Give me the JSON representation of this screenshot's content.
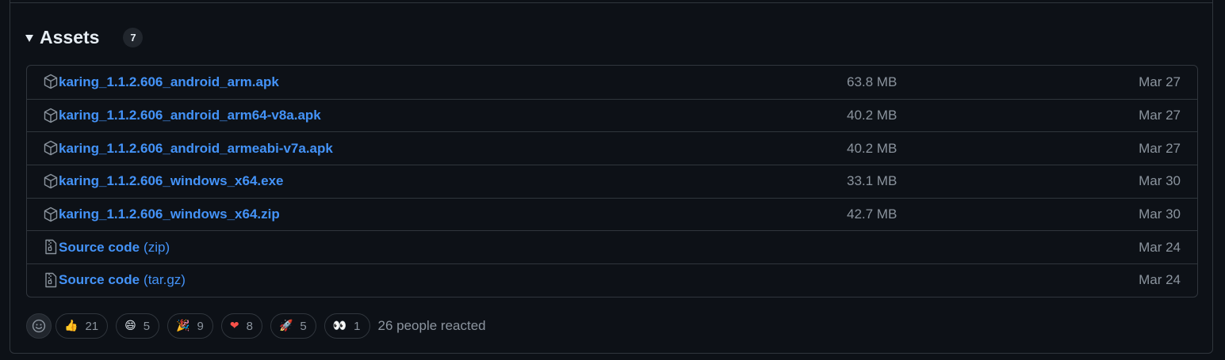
{
  "assets": {
    "title": "Assets",
    "count": "7",
    "items": [
      {
        "name": "karing_1.1.2.606_android_arm.apk",
        "suffix": "",
        "size": "63.8 MB",
        "date": "Mar 27",
        "icon": "package-icon"
      },
      {
        "name": "karing_1.1.2.606_android_arm64-v8a.apk",
        "suffix": "",
        "size": "40.2 MB",
        "date": "Mar 27",
        "icon": "package-icon"
      },
      {
        "name": "karing_1.1.2.606_android_armeabi-v7a.apk",
        "suffix": "",
        "size": "40.2 MB",
        "date": "Mar 27",
        "icon": "package-icon"
      },
      {
        "name": "karing_1.1.2.606_windows_x64.exe",
        "suffix": "",
        "size": "33.1 MB",
        "date": "Mar 30",
        "icon": "package-icon"
      },
      {
        "name": "karing_1.1.2.606_windows_x64.zip",
        "suffix": "",
        "size": "42.7 MB",
        "date": "Mar 30",
        "icon": "package-icon"
      },
      {
        "name": "Source code",
        "suffix": "(zip)",
        "size": "",
        "date": "Mar 24",
        "icon": "file-zip-icon"
      },
      {
        "name": "Source code",
        "suffix": "(tar.gz)",
        "size": "",
        "date": "Mar 24",
        "icon": "file-zip-icon"
      }
    ]
  },
  "reactions": {
    "items": [
      {
        "emoji": "👍",
        "icon": "thumbs-up-icon",
        "count": "21"
      },
      {
        "emoji": "😄",
        "icon": "smile-icon",
        "count": "5"
      },
      {
        "emoji": "🎉",
        "icon": "tada-icon",
        "count": "9"
      },
      {
        "emoji": "❤",
        "icon": "heart-icon",
        "count": "8"
      },
      {
        "emoji": "🚀",
        "icon": "rocket-icon",
        "count": "5"
      },
      {
        "emoji": "👀",
        "icon": "eyes-icon",
        "count": "1"
      }
    ],
    "summary": "26 people reacted"
  },
  "colors": {
    "background": "#0d1117",
    "border": "#30363d",
    "link": "#4493f8",
    "muted": "#8b949e",
    "heart": "#f85149"
  }
}
